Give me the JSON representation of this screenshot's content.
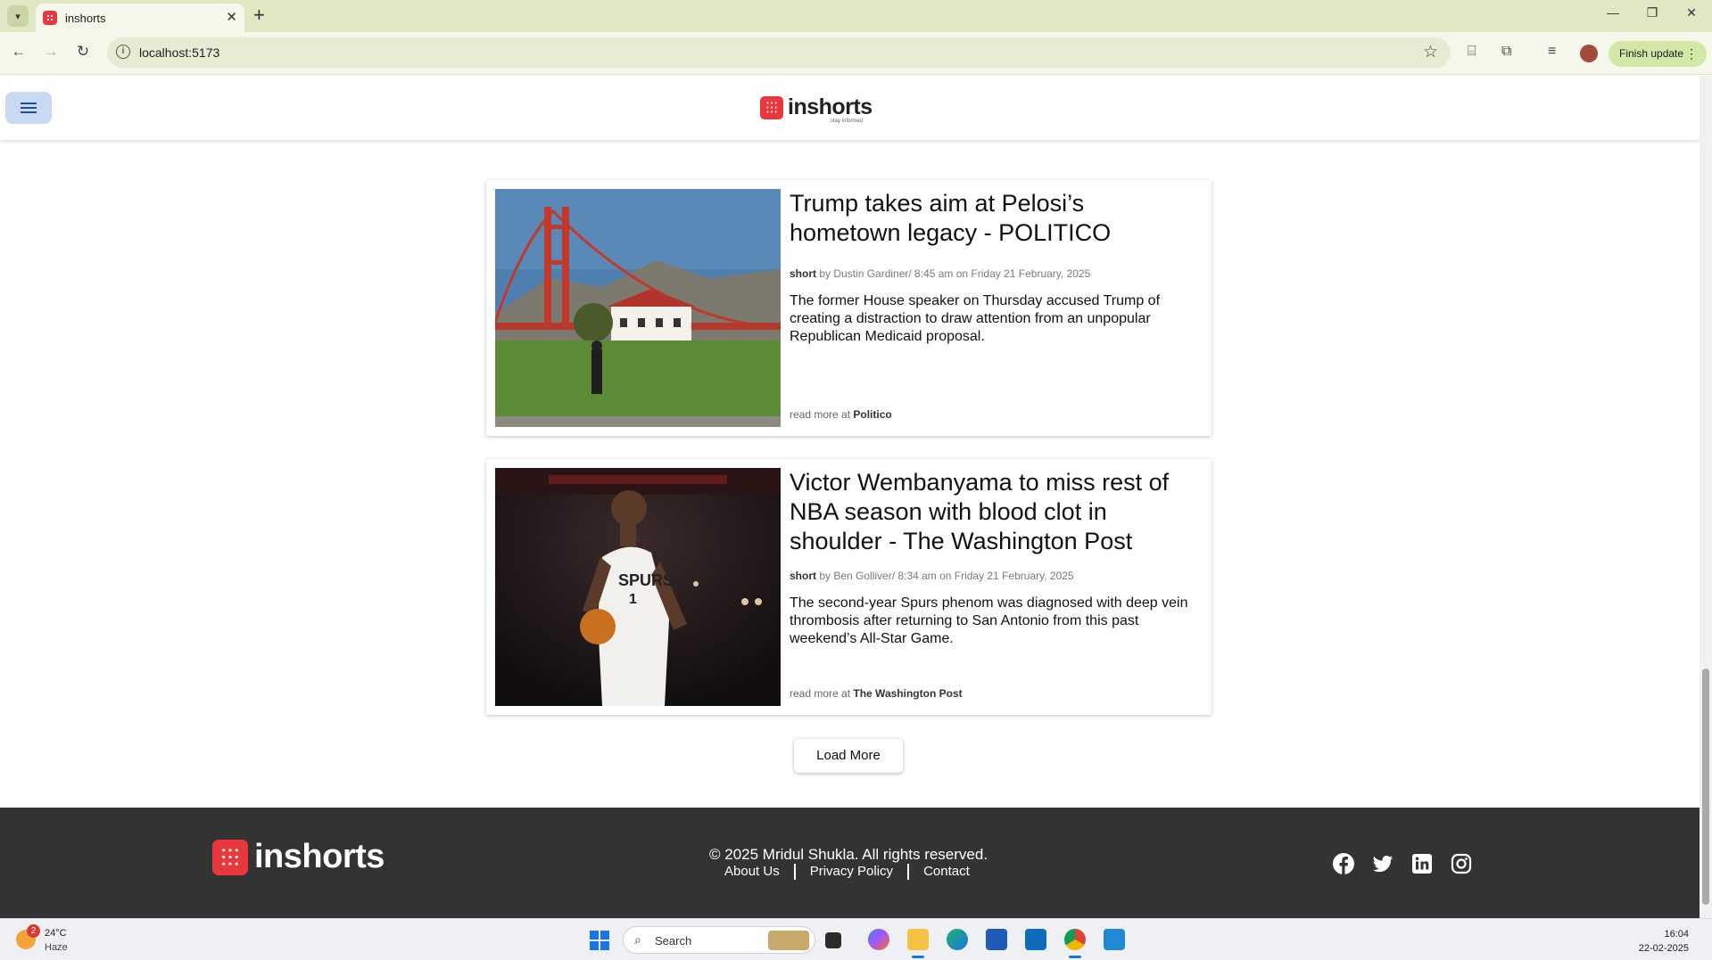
{
  "browser": {
    "tab_title": "inshorts",
    "url": "localhost:5173",
    "finish_update_label": "Finish update"
  },
  "header": {
    "logo_text": "inshorts",
    "tagline": "stay informed"
  },
  "articles": [
    {
      "headline": "Trump takes aim at Pelosi’s hometown legacy - POLITICO",
      "tag": "short",
      "byline": "by Dustin Gardiner/ 8:45 am on Friday 21 February, 2025",
      "summary": "The former House speaker on Thursday accused Trump of creating a distraction to draw attention from an unpopular Republican Medicaid proposal.",
      "read_more_prefix": "read more at",
      "source": "Politico",
      "image_icon": "golden-gate-bridge-photo"
    },
    {
      "headline": "Victor Wembanyama to miss rest of NBA season with blood clot in shoulder - The Washington Post",
      "tag": "short",
      "byline": "by Ben Golliver/ 8:34 am on Friday 21 February, 2025",
      "summary": "The second-year Spurs phenom was diagnosed with deep vein thrombosis after returning to San Antonio from this past weekend’s All-Star Game.",
      "read_more_prefix": "read more at",
      "source": "The Washington Post",
      "image_icon": "basketball-player-photo"
    }
  ],
  "load_more_label": "Load More",
  "footer": {
    "logo_text": "inshorts",
    "copyright": "© 2025 Mridul Shukla. All rights reserved.",
    "links": [
      "About Us",
      "Privacy Policy",
      "Contact"
    ],
    "social_icons": [
      "facebook-icon",
      "twitter-icon",
      "linkedin-icon",
      "instagram-icon"
    ]
  },
  "taskbar": {
    "weather_temp": "24°C",
    "weather_condition": "Haze",
    "weather_badge": "2",
    "search_placeholder": "Search",
    "time": "16:04",
    "date": "22-02-2025"
  },
  "colors": {
    "brand_red": "#e8383d",
    "footer_bg": "#333333",
    "chrome_bg": "#dfe7c3"
  }
}
